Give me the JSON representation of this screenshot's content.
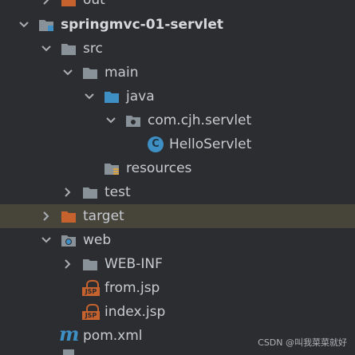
{
  "tree": {
    "out": "out",
    "project": "springmvc-01-servlet",
    "src": "src",
    "main": "main",
    "java": "java",
    "package": "com.cjh.servlet",
    "hello_servlet": "HelloServlet",
    "resources": "resources",
    "test": "test",
    "target": "target",
    "web": "web",
    "web_inf": "WEB-INF",
    "from_jsp": "from.jsp",
    "index_jsp": "index.jsp",
    "pom": "pom.xml"
  },
  "badges": {
    "class_letter": "C",
    "jsp": "JSP",
    "maven": "m"
  },
  "watermark": "CSDN @叫我菜菜就好",
  "colors": {
    "background": "#2b2d30",
    "folder_gray": "#8a9299",
    "folder_blue": "#3e8fc4",
    "folder_orange": "#c5622e",
    "highlight": "#47443a"
  },
  "icons": [
    "chevron-right-icon",
    "chevron-down-icon",
    "folder-icon",
    "module-icon",
    "source-folder-icon",
    "package-icon",
    "class-icon",
    "resources-folder-icon",
    "web-folder-icon",
    "jsp-file-icon",
    "maven-icon"
  ]
}
